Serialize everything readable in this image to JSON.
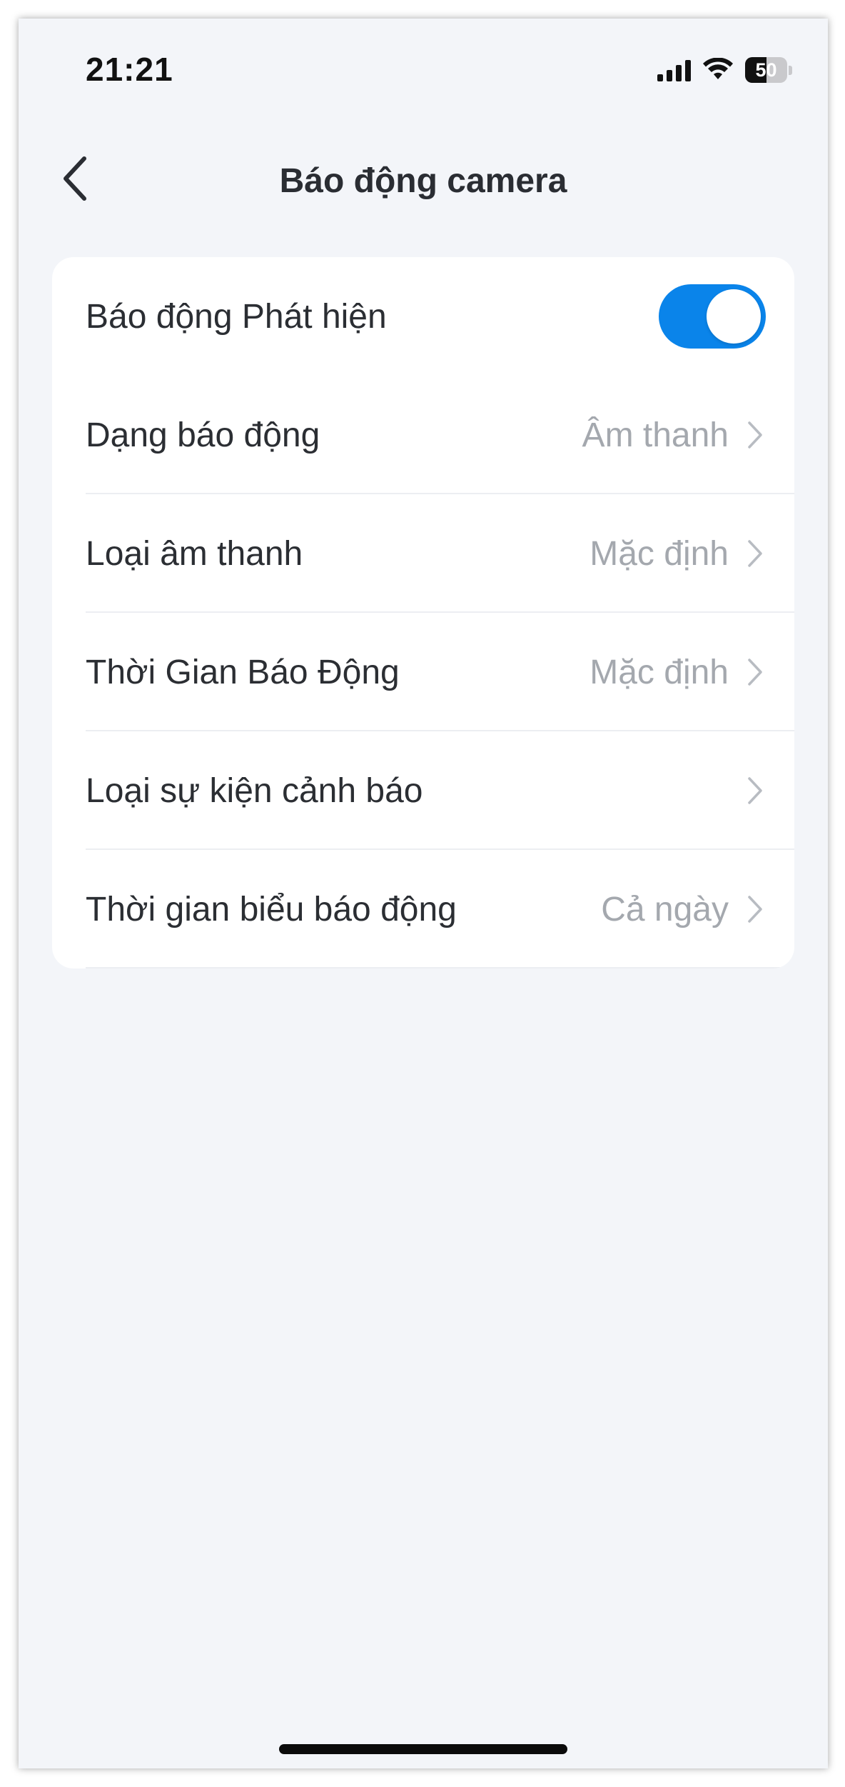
{
  "status_bar": {
    "time": "21:21",
    "battery_level": "50",
    "icons": [
      "cellular-signal-icon",
      "wifi-icon",
      "battery-icon"
    ]
  },
  "nav": {
    "title": "Báo động camera",
    "back_icon": "chevron-left-icon"
  },
  "colors": {
    "accent": "#0a84ea",
    "background": "#f3f5f9",
    "card": "#ffffff",
    "label": "#2b2e33",
    "secondary": "#a4a8ae"
  },
  "settings": {
    "detection_alarm": {
      "label": "Báo động Phát hiện",
      "enabled": true
    },
    "alarm_mode": {
      "label": "Dạng báo động",
      "value": "Âm thanh"
    },
    "sound_type": {
      "label": "Loại âm thanh",
      "value": "Mặc định"
    },
    "alarm_duration": {
      "label": "Thời Gian Báo Động",
      "value": "Mặc định"
    },
    "alert_event_type": {
      "label": "Loại sự kiện cảnh báo",
      "value": ""
    },
    "alarm_schedule": {
      "label": "Thời gian biểu báo động",
      "value": "Cả ngày"
    }
  }
}
